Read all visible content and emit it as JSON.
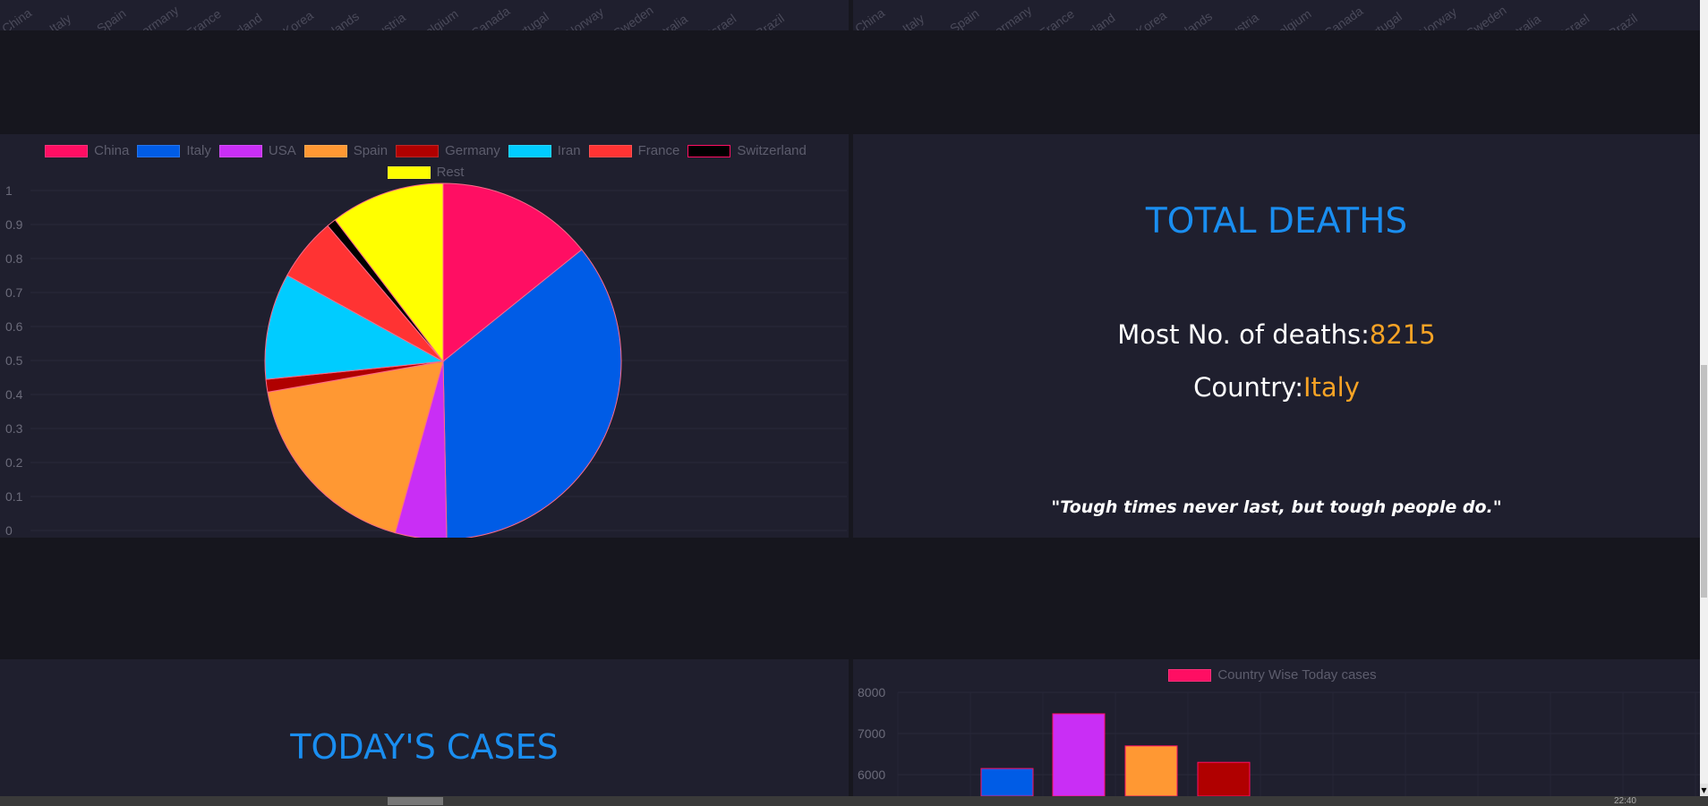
{
  "top_strip": {
    "left_ticks": [
      "China",
      "Italy",
      "Spain",
      "Germany",
      "France",
      "Switzerland",
      "S. Korea",
      "Netherlands",
      "Austria",
      "Belgium",
      "Canada",
      "Portugal",
      "Norway",
      "Sweden",
      "Australia",
      "Israel",
      "Brazil"
    ],
    "right_ticks": [
      "China",
      "Italy",
      "Spain",
      "Germany",
      "France",
      "Switzerland",
      "S. Korea",
      "Netherlands",
      "Austria",
      "Belgium",
      "Canada",
      "Portugal",
      "Norway",
      "Sweden",
      "Australia",
      "Israel",
      "Brazil"
    ]
  },
  "deaths_pie": {
    "chart_data": {
      "type": "pie",
      "categories": [
        "China",
        "Italy",
        "USA",
        "Spain",
        "Germany",
        "Iran",
        "France",
        "Switzerland",
        "Rest"
      ],
      "values": [
        3287,
        8215,
        1079,
        4145,
        267,
        2234,
        1331,
        197,
        2400
      ],
      "colors": [
        "#ff0e63",
        "#005ce6",
        "#c92ef5",
        "#ff9833",
        "#b00000",
        "#00ccff",
        "#ff3333",
        "#000000",
        "#ffff00"
      ],
      "y_ticks": [
        "0",
        "0.1",
        "0.2",
        "0.3",
        "0.4",
        "0.5",
        "0.6",
        "0.7",
        "0.8",
        "0.9",
        "1"
      ],
      "legend": "top"
    }
  },
  "total_deaths": {
    "title": "TOTAL DEATHS",
    "most_label": "Most No. of deaths:",
    "most_value": "8215",
    "country_label": "Country:",
    "country_value": "Italy",
    "quote": "\"Tough times never last, but tough people do.\""
  },
  "todays_cases": {
    "title": "TODAY'S CASES"
  },
  "today_bar": {
    "chart_data": {
      "type": "bar",
      "legend_label": "Country Wise Today cases",
      "legend_color": "#ff0e63",
      "y_ticks": [
        "8000",
        "7000",
        "6000"
      ],
      "ylim": [
        5500,
        8000
      ],
      "values": [
        6150,
        7480,
        6700,
        6300
      ],
      "colors": [
        "#005ce6",
        "#c92ef5",
        "#ff9833",
        "#b00000"
      ]
    }
  },
  "status": {
    "time": "22:40"
  }
}
